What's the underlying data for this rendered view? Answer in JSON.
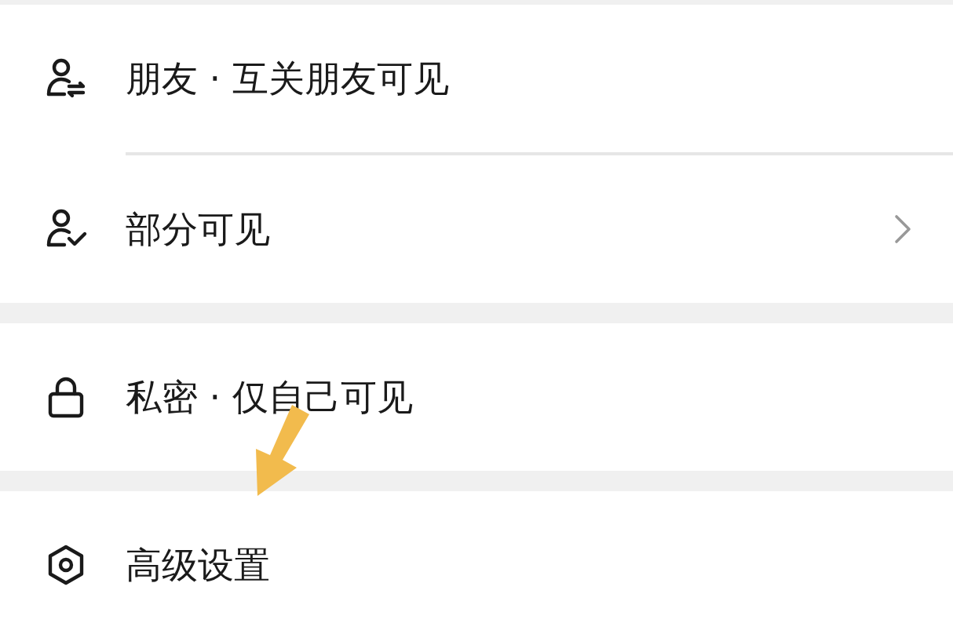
{
  "groups": [
    {
      "items": [
        {
          "kind": "person-swap",
          "label": "朋友 · 互关朋友可见",
          "chevron": false
        },
        {
          "kind": "person-check",
          "label": "部分可见",
          "chevron": true
        }
      ]
    },
    {
      "items": [
        {
          "kind": "lock",
          "label": "私密 · 仅自己可见",
          "chevron": false
        }
      ]
    },
    {
      "items": [
        {
          "kind": "hexagon",
          "label": "高级设置",
          "chevron": false
        }
      ]
    }
  ],
  "annotation": {
    "kind": "arrow",
    "color": "#f2bb4d"
  }
}
